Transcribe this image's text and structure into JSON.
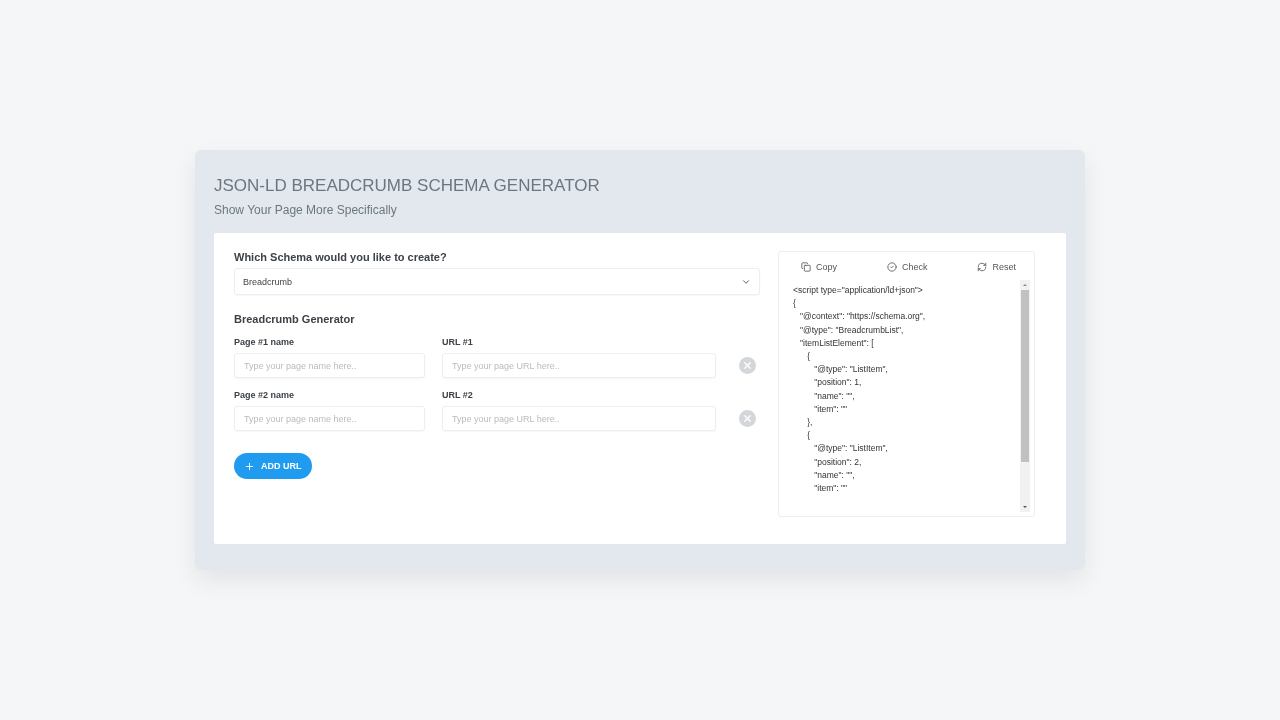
{
  "header": {
    "title": "JSON-LD BREADCRUMB SCHEMA GENERATOR",
    "subtitle": "Show Your Page More Specifically"
  },
  "schema_select": {
    "label": "Which Schema would you like to create?",
    "value": "Breadcrumb"
  },
  "generator": {
    "title": "Breadcrumb Generator",
    "rows": [
      {
        "name_label": "Page #1 name",
        "name_placeholder": "Type your page name here..",
        "url_label": "URL #1",
        "url_placeholder": "Type your page URL here.."
      },
      {
        "name_label": "Page #2 name",
        "name_placeholder": "Type your page name here..",
        "url_label": "URL #2",
        "url_placeholder": "Type your page URL here.."
      }
    ],
    "add_button": "ADD URL"
  },
  "code_panel": {
    "actions": [
      {
        "kind": "copy",
        "label": "Copy"
      },
      {
        "kind": "check",
        "label": "Check"
      },
      {
        "kind": "reset",
        "label": "Reset"
      }
    ],
    "lines": [
      "<script type=\"application/ld+json\">",
      "{",
      "   \"@context\": \"https://schema.org\",",
      "   \"@type\": \"BreadcrumbList\",",
      "   \"itemListElement\": [",
      "      {",
      "         \"@type\": \"ListItem\",",
      "         \"position\": 1,",
      "         \"name\": \"\",",
      "         \"item\": \"\"",
      "      },",
      "      {",
      "         \"@type\": \"ListItem\",",
      "         \"position\": 2,",
      "         \"name\": \"\",",
      "         \"item\": \"\""
    ]
  }
}
